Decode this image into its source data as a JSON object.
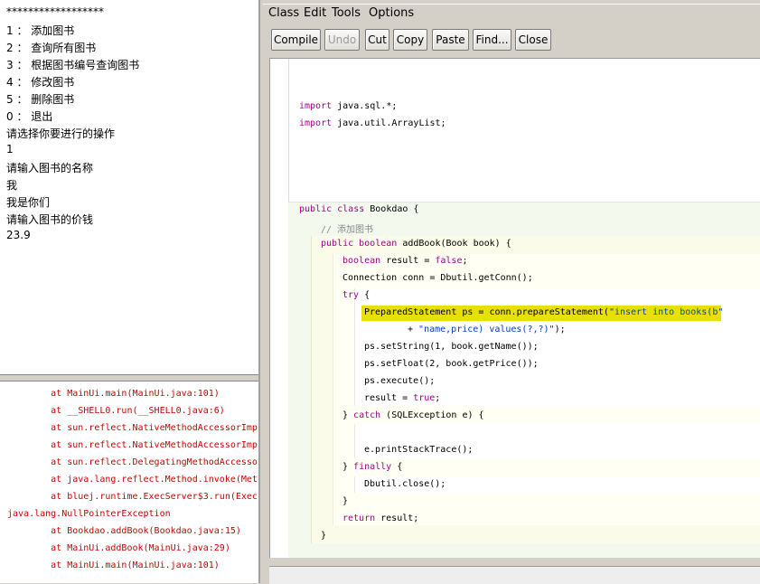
{
  "terminal": {
    "output_lines": [
      "******************",
      "1 ： 添加图书",
      "2 ： 查询所有图书",
      "3 ： 根据图书编号查询图书",
      "4 ： 修改图书",
      "5 ： 删除图书",
      "0 ： 退出",
      "请选择你要进行的操作",
      "1",
      "请输入图书的名称",
      "我",
      "我是你们",
      "请输入图书的价钱",
      "23.9"
    ],
    "error_lines": [
      "        at MainUi.main(MainUi.java:101)",
      "        at __SHELL0.run(__SHELL0.java:6)",
      "        at sun.reflect.NativeMethodAccessorImpl",
      "        at sun.reflect.NativeMethodAccessorImpl",
      "        at sun.reflect.DelegatingMethodAccessor",
      "        at java.lang.reflect.Method.invoke(Met",
      "        at bluej.runtime.ExecServer$3.run(Exec",
      "java.lang.NullPointerException",
      "        at Bookdao.addBook(Bookdao.java:15)",
      "        at MainUi.addBook(MainUi.java:29)",
      "        at MainUi.main(MainUi.java:101)"
    ]
  },
  "editor": {
    "menus": [
      "Class",
      "Edit",
      "Tools",
      "Options"
    ],
    "toolbar": {
      "compile": "Compile",
      "undo": "Undo",
      "cut": "Cut",
      "copy": "Copy",
      "paste": "Paste",
      "find": "Find...",
      "close": "Close"
    },
    "code": {
      "import1_kw": "import",
      "import1_rest": " java.sql.*;",
      "import2_kw": "import",
      "import2_rest": " java.util.ArrayList;",
      "class_kw": "public class",
      "class_rest": " Bookdao {",
      "comment": "// 添加图书",
      "method_kw": "public boolean",
      "method_rest": " addBook(Book book) {",
      "l_bool_kw": "boolean",
      "l_bool_mid": " result = ",
      "l_bool_val": "false",
      "l_bool_end": ";",
      "l_conn": "Connection conn = Dbutil.getConn();",
      "l_try_kw": "try",
      "l_try_rest": " {",
      "l_ps_a": "PreparedStatement ps = conn.prepareStatement(",
      "l_ps_str": "\"insert into books(b\"",
      "l_ps2_a": "+ ",
      "l_ps2_str": "\"name,price) values(?,?)\"",
      "l_ps2_end": ");",
      "l_set1": "ps.setString(1, book.getName());",
      "l_set2": "ps.setFloat(2, book.getPrice());",
      "l_exec": "ps.execute();",
      "l_res_a": "result = ",
      "l_res_val": "true",
      "l_res_end": ";",
      "l_catch_a": "} ",
      "l_catch_kw": "catch",
      "l_catch_rest": " (SQLException e) {",
      "l_stack": "e.printStackTrace();",
      "l_fin_a": "} ",
      "l_fin_kw": "finally",
      "l_fin_rest": " {",
      "l_close": "Dbutil.close();",
      "l_brace1": "}",
      "l_ret_kw": "return",
      "l_ret_rest": " result;",
      "l_brace2": "}"
    }
  }
}
